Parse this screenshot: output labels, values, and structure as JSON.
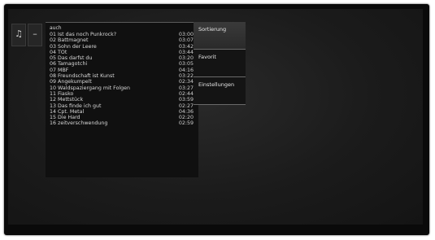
{
  "side_buttons": [
    {
      "icon": "music-note-icon",
      "glyph": "♫"
    },
    {
      "icon": "dash-icon",
      "glyph": "–"
    }
  ],
  "playlist": {
    "header": "auch",
    "tracks": [
      {
        "title": "01 Ist das noch Punkrock?",
        "duration": "03:00"
      },
      {
        "title": "02 Battmagnet",
        "duration": "03:07"
      },
      {
        "title": "03 Sohn der Leere",
        "duration": "03:42"
      },
      {
        "title": "04 TOt",
        "duration": "03:44"
      },
      {
        "title": "05 Das darfst du",
        "duration": "03:20"
      },
      {
        "title": "06 Tamagotchi",
        "duration": "03:05"
      },
      {
        "title": "07 MBF",
        "duration": "04:16"
      },
      {
        "title": "08 Freundschaft ist Kunst",
        "duration": "03:22"
      },
      {
        "title": "09 Angekumpelt",
        "duration": "02:34"
      },
      {
        "title": "10 Waldspaziergang mit Folgen",
        "duration": "03:27"
      },
      {
        "title": "11 Fiasko",
        "duration": "02:44"
      },
      {
        "title": "12 Mettstück",
        "duration": "03:59"
      },
      {
        "title": "13 Das finde ich gut",
        "duration": "02:27"
      },
      {
        "title": "14 Cpt. Metal",
        "duration": "04:36"
      },
      {
        "title": "15 Die Hard",
        "duration": "02:20"
      },
      {
        "title": "16 zeitverschwendung",
        "duration": "02:59"
      }
    ]
  },
  "menu": {
    "items": [
      {
        "label": "Sortierung",
        "active": true
      },
      {
        "label": "Favorit",
        "active": false
      },
      {
        "label": "Einstellungen",
        "active": false
      }
    ]
  }
}
